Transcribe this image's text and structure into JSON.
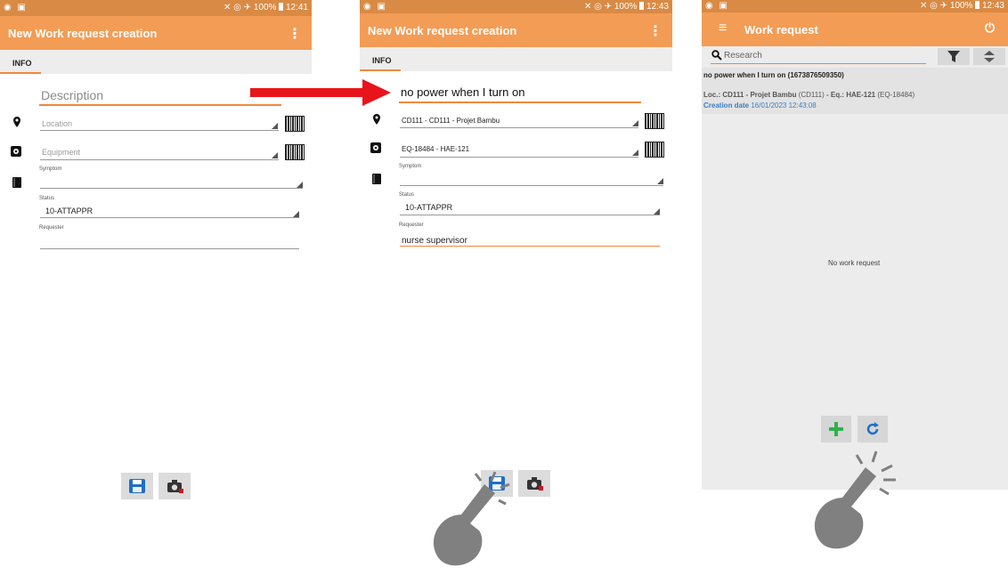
{
  "status_bar": {
    "screen1": {
      "left_icons": "◉ ▣",
      "right_icons": "✕ ◎ ✈",
      "battery": "100%",
      "time": "12:41"
    },
    "screen2": {
      "left_icons": "◉ ▣",
      "right_icons": "✕ ◎ ✈",
      "battery": "100%",
      "time": "12:43"
    },
    "screen3": {
      "left_icons": "◉ ▣",
      "right_icons": "✕ ◎ ✈",
      "battery": "100%",
      "time": "12:43"
    }
  },
  "screen1": {
    "title": "New Work request creation",
    "menu": "⋮",
    "tab": "INFO",
    "description_placeholder": "Description",
    "location_placeholder": "Location",
    "equipment_placeholder": "Equipment",
    "symptom_label": "Symptom",
    "status_label": "Status",
    "status_value": "10-ATTAPPR",
    "requester_label": "Requester"
  },
  "screen2": {
    "title": "New Work request creation",
    "menu": "⋮",
    "tab": "INFO",
    "description_value": "no power when I turn on",
    "location_value": "CD111 - CD111 - Projet Bambu",
    "equipment_value": "EQ-18484 - HAE-121",
    "symptom_label": "Symptom",
    "status_label": "Status",
    "status_value": "10-ATTAPPR",
    "requester_label": "Requester",
    "requester_value": "nurse supervisor"
  },
  "screen3": {
    "menu": "≡",
    "title": "Work request",
    "power": "⏻",
    "search_placeholder": "Research",
    "item": {
      "title": "no power when I turn on (1673876509350)",
      "loc_prefix": "Loc.: ",
      "loc_value": "CD111 - Projet Bambu",
      "loc_code": " (CD111)",
      "eq_prefix": " - Eq.: ",
      "eq_value": "HAE-121",
      "eq_code": " (EQ-18484)",
      "date_label": "Creation date ",
      "date_value": "16/01/2023 12:43:08"
    },
    "empty_text": "No work request"
  },
  "colors": {
    "appbar": "#f39c55",
    "statusbar": "#d98a44",
    "accent_orange": "#f0883e",
    "arrow_red": "#e8141b",
    "save_blue": "#1e6fc4",
    "add_green": "#2fb24a",
    "date_blue": "#3a7fc4"
  },
  "icons": [
    "location-pin-icon",
    "equipment-gear-icon",
    "book-icon",
    "barcode-icon",
    "save-icon",
    "camera-icon",
    "search-icon",
    "filter-icon",
    "sort-icon",
    "hamburger-menu-icon",
    "power-icon",
    "add-icon",
    "refresh-icon",
    "hand-pointer-icon",
    "red-arrow-icon"
  ]
}
